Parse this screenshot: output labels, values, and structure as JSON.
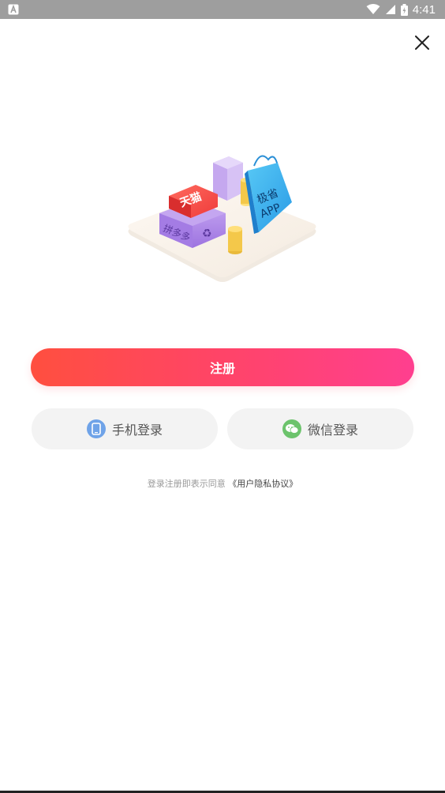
{
  "status_bar": {
    "time": "4:41",
    "left_icon": "notification-a-icon",
    "right_icons": [
      "wifi-icon",
      "signal-icon",
      "battery-icon"
    ]
  },
  "close_icon": "close-icon",
  "illustration": {
    "tmall_label": "天猫",
    "pdd_label": "拼多多",
    "bag_label_line1": "极省",
    "bag_label_line2": "APP"
  },
  "register_button": {
    "label": "注册"
  },
  "phone_login": {
    "label": "手机登录",
    "icon": "phone-icon",
    "icon_color": "#6fa3e8"
  },
  "wechat_login": {
    "label": "微信登录",
    "icon": "wechat-icon",
    "icon_color": "#6cc36c"
  },
  "agreement": {
    "prefix": "登录注册即表示同意",
    "link": "《用户隐私协议》"
  },
  "colors": {
    "register_gradient_start": "#ff4f3f",
    "register_gradient_end": "#ff3f8f"
  }
}
